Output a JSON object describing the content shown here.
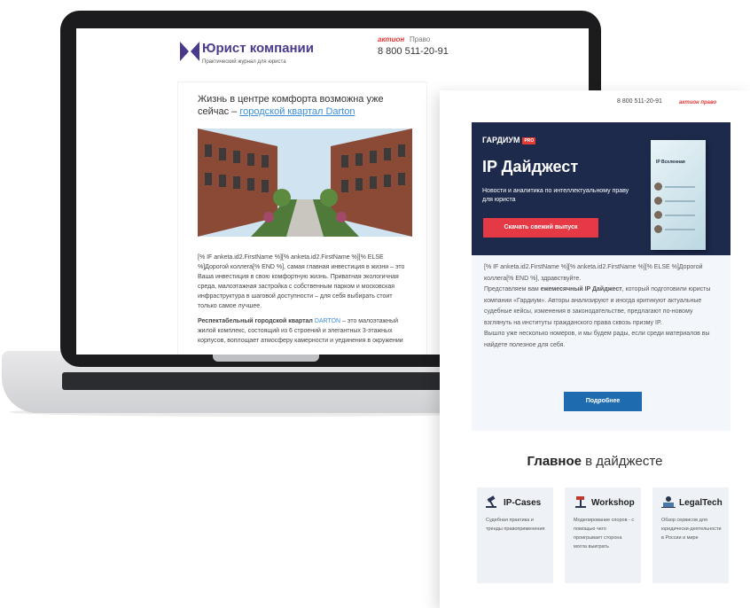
{
  "laptop_email": {
    "brand": "Юрист компании",
    "tagline": "Практический журнал для юриста",
    "aktion_label": "актион",
    "pravo_label": "Право",
    "phone": "8 800 511-20-91",
    "headline": "Жизнь в центре комфорта возможна уже сейчас –",
    "headline_link": "городской квартал Darton",
    "body_p1": "[% IF anketa.id2.FirstName %][% anketa.id2.FirstName %][% ELSE %]Дорогой коллега[% END %], самая главная инвестиция в жизни – это Ваша инвестиция в свою комфортную жизнь. Приватная экологичная среда, малоэтажная застройка с собственным парком и московская инфраструктура в шаговой доступности – для себя выбирать стоит только самое лучшее.",
    "body_p2_bold": "Респектабельный городской квартал",
    "body_p2_link": "DARTON",
    "body_p2_rest": "– это малоэтажный жилой комплекс, состоящий из 6 строений и элегантных 3-этажных корпусов, воплощает атмосферу камерности и уединения в окружении"
  },
  "digest_email": {
    "phone": "8 800 511-20-91",
    "aktion_label": "актион право",
    "brand": "ГАРДИУМ",
    "brand_badge": "PRO",
    "title": "IP Дайджест",
    "subtitle": "Новости и аналитика по интеллектуальному праву для юриста",
    "download_button": "Скачать свежий выпуск",
    "book_title": "IP Вселенная",
    "body_line1": "[% IF anketa.id2.FirstName %][% anketa.id2.FirstName %][% ELSE %]Дорогой коллега[% END %], здравствуйте.",
    "body_line2_pre": "Представляем вам",
    "body_line2_bold": "ежемесячный IP Дайджест",
    "body_line2_post": ", который подготовили юристы компании «Гардиум». Авторы анализируют и иногда критикуют актуальные судебные кейсы, изменения в законодательстве, предлагают по-новому взглянуть на институты гражданского права сквозь призму IP.",
    "body_line3": "Вышло уже несколько номеров, и мы будем рады, если среди материалов вы найдете полезное для себя.",
    "more_button": "Подробнее",
    "main_heading_bold": "Главное",
    "main_heading_rest": "в дайджесте",
    "cards": [
      {
        "title": "IP-Cases",
        "desc": "Судебная практика и тренды правоприменения",
        "icon": "gavel-icon"
      },
      {
        "title": "Workshop",
        "desc": "Моделирование споров - с помощью чего проигрывает сторона могла выиграть",
        "icon": "hammer-icon"
      },
      {
        "title": "LegalTech",
        "desc": "Обзор сервисов для юридически-деятельности в России и мире",
        "icon": "laptop-user-icon"
      }
    ]
  },
  "colors": {
    "brand_purple": "#4b3a8c",
    "link_blue": "#3b8ed8",
    "hero_navy": "#1e2a4c",
    "cta_red": "#e53945",
    "cta_blue": "#1e6bb0"
  }
}
